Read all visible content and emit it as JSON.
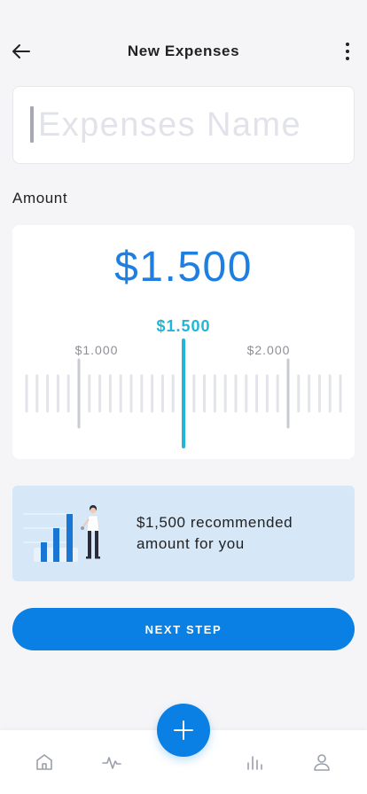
{
  "header": {
    "title": "New Expenses",
    "back_icon": "arrow-left-icon",
    "menu_icon": "more-vertical-icon"
  },
  "expense_name": {
    "placeholder": "Expenses Name",
    "value": ""
  },
  "amount": {
    "label": "Amount",
    "display": "$1.500",
    "slider": {
      "current_label": "$1.500",
      "tick_labels": [
        "$1.000",
        "$2.000"
      ],
      "value": 1500,
      "min_visible": 750,
      "max_visible": 2250
    }
  },
  "recommendation": {
    "text": "$1,500 recommended amount for you",
    "illustration": "bar-chart-person-illustration"
  },
  "next_button": {
    "label": "NEXT STEP"
  },
  "bottom_nav": {
    "items": [
      {
        "icon": "home-icon"
      },
      {
        "icon": "activity-icon"
      },
      {
        "icon": "bar-chart-icon"
      },
      {
        "icon": "user-icon"
      }
    ],
    "fab_icon": "plus-icon"
  },
  "colors": {
    "accent": "#0a80e4",
    "amount_blue": "#1f7fe0",
    "slider_cyan": "#22b5d6",
    "card_blue": "#d6e8f8"
  }
}
